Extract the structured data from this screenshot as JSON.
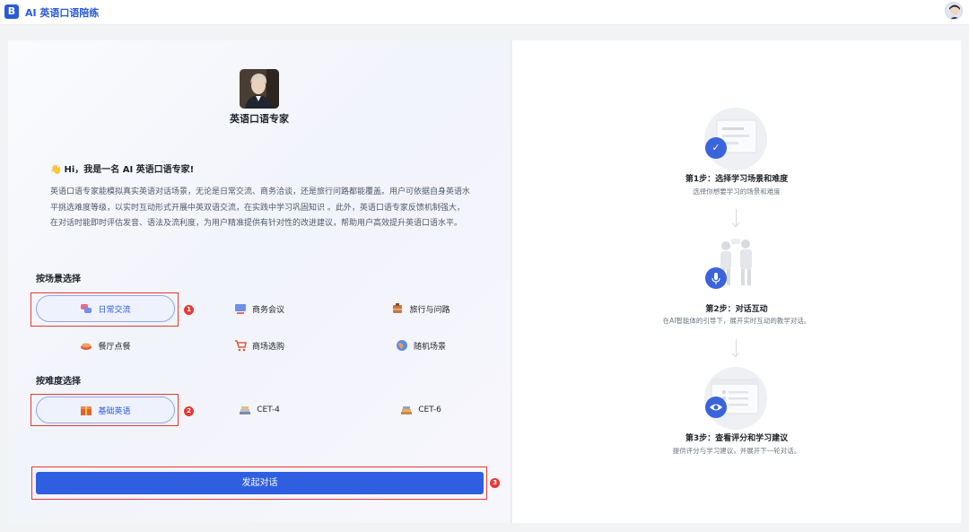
{
  "app": {
    "logo_letter": "B",
    "title": "AI 英语口语陪练"
  },
  "expert": {
    "name": "英语口语专家"
  },
  "greeting": {
    "emoji": "👋",
    "text": "Hi，我是一名 AI 英语口语专家!"
  },
  "intro": "英语口语专家能模拟真实英语对话场景，无论是日常交流、商务洽谈，还是旅行问路都能覆盖。用户可依据自身英语水平挑选难度等级，以实时互动形式开展中英双语交流，在实践中学习巩固知识 。此外，英语口语专家反馈机制强大，在对话时能即时评估发音、语法及流利度，为用户精准提供有针对性的改进建议，帮助用户高效提升英语口语水平。",
  "scene_section": {
    "title": "按场景选择",
    "options": [
      {
        "label": "日常交流",
        "icon": "chat-bubbles-icon",
        "selected": true
      },
      {
        "label": "商务会议",
        "icon": "meeting-icon",
        "selected": false
      },
      {
        "label": "旅行与问路",
        "icon": "travel-icon",
        "selected": false
      },
      {
        "label": "餐厅点餐",
        "icon": "food-icon",
        "selected": false
      },
      {
        "label": "商场选购",
        "icon": "shopping-cart-icon",
        "selected": false
      },
      {
        "label": "随机场景",
        "icon": "globe-icon",
        "selected": false
      }
    ]
  },
  "difficulty_section": {
    "title": "按难度选择",
    "options": [
      {
        "label": "基础英语",
        "icon": "gift-box-icon",
        "selected": true
      },
      {
        "label": "CET-4",
        "icon": "book-stack-icon",
        "selected": false
      },
      {
        "label": "CET-6",
        "icon": "books-icon",
        "selected": false
      }
    ]
  },
  "annotations": [
    "1",
    "2",
    "3"
  ],
  "start_button": {
    "label": "发起对话"
  },
  "steps": [
    {
      "title": "第1步：选择学习场景和难度",
      "desc": "选择你想要学习的场景和难度",
      "icon": "check-icon"
    },
    {
      "title": "第2步：对话互动",
      "desc": "在AI智能体的引导下，展开实时互动的教学对话。",
      "icon": "microphone-icon"
    },
    {
      "title": "第3步：查看评分和学习建议",
      "desc": "提供评分与学习建议，并展开下一轮对话。",
      "icon": "eye-icon"
    }
  ],
  "colors": {
    "accent": "#2f5fe0",
    "annotation": "#e53935",
    "brand": "#2a5bd7"
  }
}
